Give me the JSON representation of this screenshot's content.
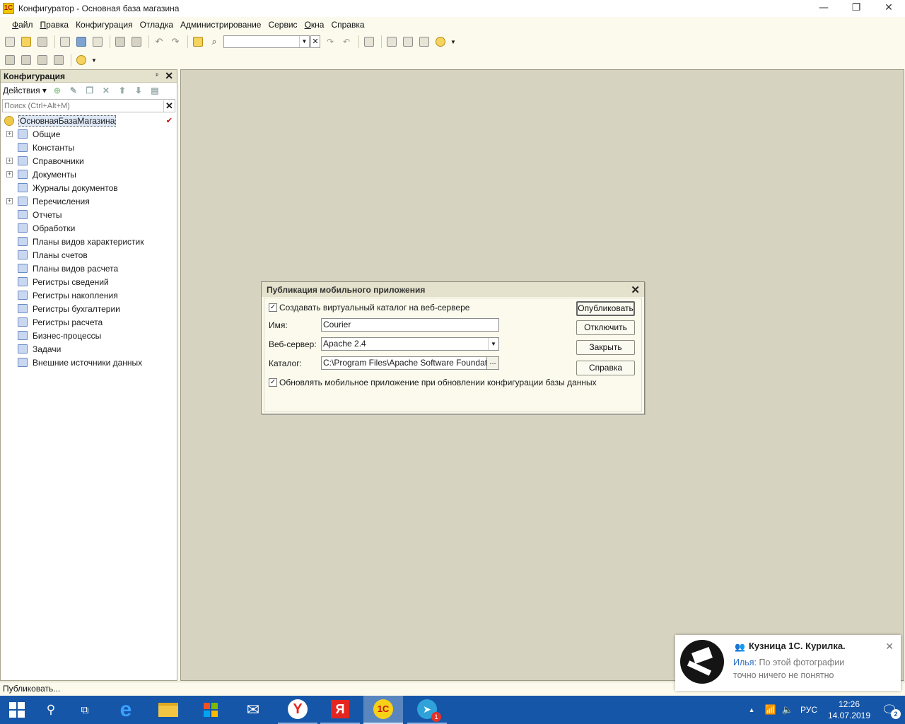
{
  "window": {
    "title": "Конфигуратор - Основная база магазина",
    "icon_text": "1С"
  },
  "menu": [
    {
      "label": "Файл",
      "underline": "Ф",
      "rest": "айл"
    },
    {
      "label": "Правка",
      "underline": "П",
      "rest": "равка"
    },
    {
      "label": "Конфигурация",
      "underline": "",
      "rest": "Конфигурация"
    },
    {
      "label": "Отладка",
      "underline": "",
      "rest": "Отладка"
    },
    {
      "label": "Администрирование",
      "underline": "",
      "rest": "Администрирование"
    },
    {
      "label": "Сервис",
      "underline": "",
      "rest": "Сервис"
    },
    {
      "label": "Окна",
      "underline": "О",
      "rest": "кна"
    },
    {
      "label": "Справка",
      "underline": "",
      "rest": "Справка"
    }
  ],
  "config_panel": {
    "title": "Конфигурация",
    "actions_label": "Действия ▾",
    "search_placeholder": "Поиск (Ctrl+Alt+M)",
    "root": "ОсновнаяБазаМагазина",
    "items": [
      {
        "label": "Общие",
        "expandable": true
      },
      {
        "label": "Константы",
        "expandable": false
      },
      {
        "label": "Справочники",
        "expandable": true
      },
      {
        "label": "Документы",
        "expandable": true
      },
      {
        "label": "Журналы документов",
        "expandable": false
      },
      {
        "label": "Перечисления",
        "expandable": true
      },
      {
        "label": "Отчеты",
        "expandable": false
      },
      {
        "label": "Обработки",
        "expandable": false
      },
      {
        "label": "Планы видов характеристик",
        "expandable": false
      },
      {
        "label": "Планы счетов",
        "expandable": false
      },
      {
        "label": "Планы видов расчета",
        "expandable": false
      },
      {
        "label": "Регистры сведений",
        "expandable": false
      },
      {
        "label": "Регистры накопления",
        "expandable": false
      },
      {
        "label": "Регистры бухгалтерии",
        "expandable": false
      },
      {
        "label": "Регистры расчета",
        "expandable": false
      },
      {
        "label": "Бизнес-процессы",
        "expandable": false
      },
      {
        "label": "Задачи",
        "expandable": false
      },
      {
        "label": "Внешние источники данных",
        "expandable": false
      }
    ]
  },
  "dialog": {
    "title": "Публикация мобильного приложения",
    "create_catalog_label": "Создавать виртуальный каталог на веб-сервере",
    "create_catalog_checked": true,
    "name_label": "Имя:",
    "name_value": "Courier",
    "webserver_label": "Веб-сервер:",
    "webserver_value": "Apache 2.4",
    "catalog_label": "Каталог:",
    "catalog_value": "C:\\Program Files\\Apache Software Foundation\\A",
    "browse_label": "...",
    "update_label": "Обновлять мобильное приложение при обновлении конфигурации базы данных",
    "update_checked": true,
    "buttons": {
      "publish": "Опубликовать",
      "disable": "Отключить",
      "close": "Закрыть",
      "help": "Справка"
    }
  },
  "status": "Публиковать...",
  "notification": {
    "title": "Кузница 1С. Курилка.",
    "author": "Илья:",
    "message": "По этой фотографии точно ничего не понятно"
  },
  "taskbar": {
    "language": "РУС",
    "time": "12:26",
    "date": "14.07.2019",
    "notifications_count": "2",
    "telegram_badge": "1",
    "yandex_label": "Я",
    "onec_label": "1С"
  }
}
